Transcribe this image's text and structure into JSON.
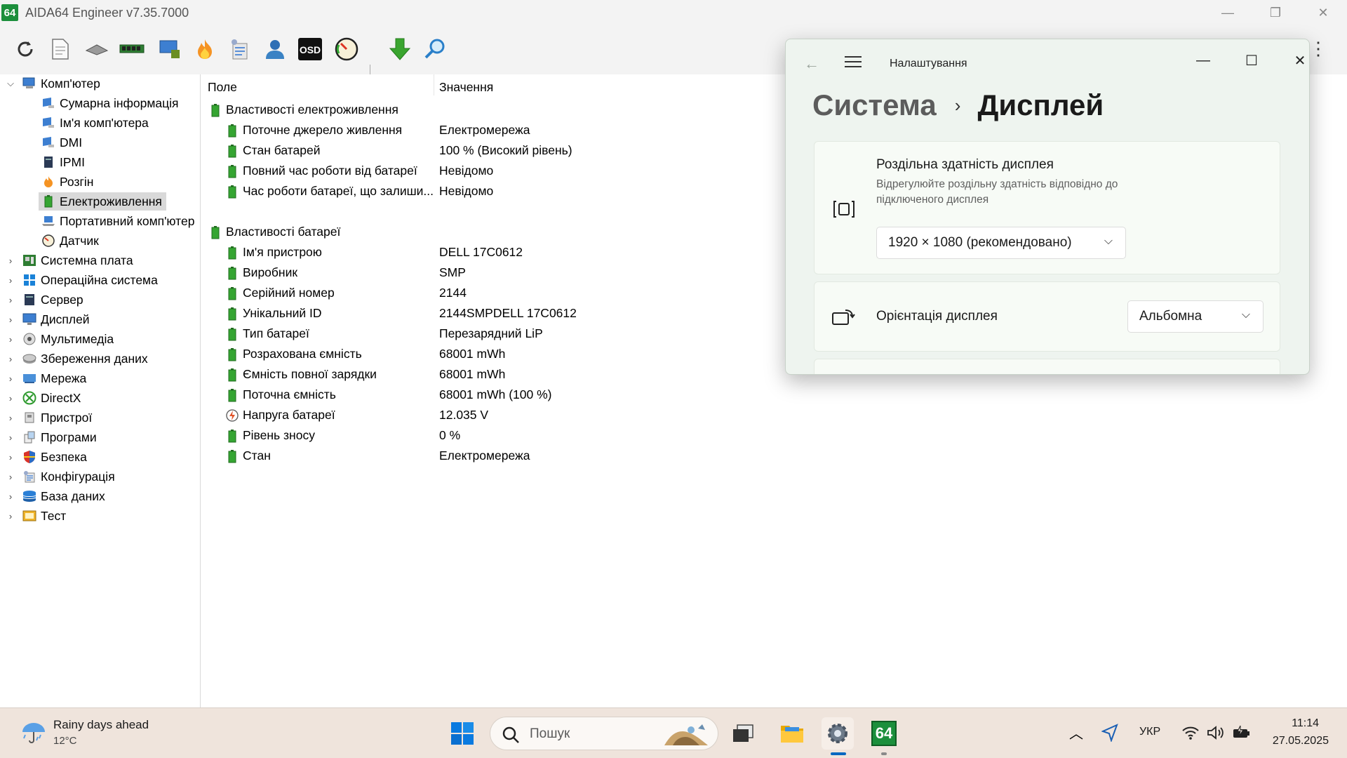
{
  "app": {
    "icon_label": "64",
    "title": "AIDA64 Engineer v7.35.7000"
  },
  "tree": {
    "items": [
      {
        "label": "Комп'ютер"
      },
      {
        "label": "Сумарна інформація"
      },
      {
        "label": "Ім'я комп'ютера"
      },
      {
        "label": "DMI"
      },
      {
        "label": "IPMI"
      },
      {
        "label": "Розгін"
      },
      {
        "label": "Електроживлення"
      },
      {
        "label": "Портативний комп'ютер"
      },
      {
        "label": "Датчик"
      },
      {
        "label": "Системна плата"
      },
      {
        "label": "Операційна система"
      },
      {
        "label": "Сервер"
      },
      {
        "label": "Дисплей"
      },
      {
        "label": "Мультимедіа"
      },
      {
        "label": "Збереження даних"
      },
      {
        "label": "Мережа"
      },
      {
        "label": "DirectX"
      },
      {
        "label": "Пристрої"
      },
      {
        "label": "Програми"
      },
      {
        "label": "Безпека"
      },
      {
        "label": "Конфігурація"
      },
      {
        "label": "База даних"
      },
      {
        "label": "Тест"
      }
    ]
  },
  "list": {
    "headers": {
      "field": "Поле",
      "value": "Значення"
    },
    "rows": [
      {
        "field": "Властивості електроживлення",
        "value": ""
      },
      {
        "field": "Поточне джерело живлення",
        "value": "Електромережа"
      },
      {
        "field": "Стан батарей",
        "value": "100 % (Високий рівень)"
      },
      {
        "field": "Повний час роботи від батареї",
        "value": "Невідомо"
      },
      {
        "field": "Час роботи батареї, що залиши...",
        "value": "Невідомо"
      },
      {
        "field": "Властивості батареї",
        "value": ""
      },
      {
        "field": "Ім'я пристрою",
        "value": "DELL 17C0612"
      },
      {
        "field": "Виробник",
        "value": "SMP"
      },
      {
        "field": "Серійний номер",
        "value": "2144"
      },
      {
        "field": "Унікальний ID",
        "value": "2144SMPDELL 17C0612"
      },
      {
        "field": "Тип батареї",
        "value": "Перезарядний LiP"
      },
      {
        "field": "Розрахована ємність",
        "value": "68001 mWh"
      },
      {
        "field": "Ємність повної зарядки",
        "value": "68001 mWh"
      },
      {
        "field": "Поточна ємність",
        "value": "68001 mWh  (100 %)"
      },
      {
        "field": "Напруга батареї",
        "value": "12.035 V"
      },
      {
        "field": "Рівень зносу",
        "value": "0 %"
      },
      {
        "field": "Стан",
        "value": "Електромережа"
      }
    ]
  },
  "settings": {
    "app_title": "Налаштування",
    "breadcrumb_parent": "Система",
    "breadcrumb_page": "Дисплей",
    "resolution": {
      "title": "Роздільна здатність дисплея",
      "description": "Відрегулюйте роздільну здатність відповідно до  підключеного дисплея",
      "selected": "1920 × 1080 (рекомендовано)"
    },
    "orientation": {
      "title": "Орієнтація дисплея",
      "selected": "Альбомна"
    }
  },
  "taskbar": {
    "weather_title": "Rainy days ahead",
    "weather_temp": "12°C",
    "search_placeholder": "Пошук",
    "aida_label": "64",
    "language": "УКР",
    "time": "11:14",
    "date": "27.05.2025"
  },
  "colors": {
    "aida_green": "#1c8f3c",
    "settings_bg": "#eef4ef",
    "taskbar_bg": "#efe4dc",
    "accent_blue": "#0067c0"
  }
}
